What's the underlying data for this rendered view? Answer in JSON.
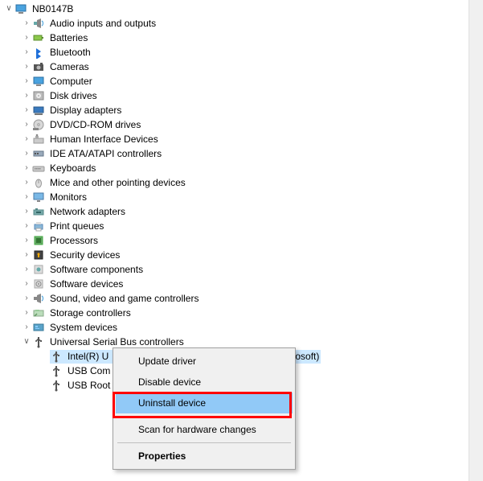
{
  "root": {
    "label": "NB0147B"
  },
  "categories": [
    {
      "id": "audio",
      "label": "Audio inputs and outputs",
      "icon": "audio"
    },
    {
      "id": "batteries",
      "label": "Batteries",
      "icon": "battery"
    },
    {
      "id": "bluetooth",
      "label": "Bluetooth",
      "icon": "bluetooth"
    },
    {
      "id": "cameras",
      "label": "Cameras",
      "icon": "camera"
    },
    {
      "id": "computer",
      "label": "Computer",
      "icon": "monitor"
    },
    {
      "id": "diskdrives",
      "label": "Disk drives",
      "icon": "disk"
    },
    {
      "id": "displayadapters",
      "label": "Display adapters",
      "icon": "display-adapter"
    },
    {
      "id": "dvd",
      "label": "DVD/CD-ROM drives",
      "icon": "dvd"
    },
    {
      "id": "hid",
      "label": "Human Interface Devices",
      "icon": "hid"
    },
    {
      "id": "ide",
      "label": "IDE ATA/ATAPI controllers",
      "icon": "ide"
    },
    {
      "id": "keyboards",
      "label": "Keyboards",
      "icon": "keyboard"
    },
    {
      "id": "mice",
      "label": "Mice and other pointing devices",
      "icon": "mouse"
    },
    {
      "id": "monitors",
      "label": "Monitors",
      "icon": "monitor2"
    },
    {
      "id": "netadapters",
      "label": "Network adapters",
      "icon": "net"
    },
    {
      "id": "printqueues",
      "label": "Print queues",
      "icon": "printer"
    },
    {
      "id": "processors",
      "label": "Processors",
      "icon": "cpu"
    },
    {
      "id": "security",
      "label": "Security devices",
      "icon": "security"
    },
    {
      "id": "swcomp",
      "label": "Software components",
      "icon": "swcomp"
    },
    {
      "id": "swdev",
      "label": "Software devices",
      "icon": "swdev"
    },
    {
      "id": "sound",
      "label": "Sound, video and game controllers",
      "icon": "sound"
    },
    {
      "id": "storage",
      "label": "Storage controllers",
      "icon": "storage"
    },
    {
      "id": "system",
      "label": "System devices",
      "icon": "system"
    },
    {
      "id": "usb",
      "label": "Universal Serial Bus controllers",
      "icon": "usb",
      "expanded": true
    }
  ],
  "usb_children": [
    {
      "id": "usb-intel",
      "label_visible_prefix": "Intel(R) U",
      "label_visible_suffix": "osoft)",
      "selected": true
    },
    {
      "id": "usb-com",
      "label_visible_prefix": "USB Com"
    },
    {
      "id": "usb-root",
      "label_visible_prefix": "USB Root"
    }
  ],
  "context_menu": {
    "items": [
      {
        "id": "update-driver",
        "label": "Update driver"
      },
      {
        "id": "disable-device",
        "label": "Disable device"
      },
      {
        "id": "uninstall-device",
        "label": "Uninstall device",
        "highlighted": true
      },
      {
        "sep": true
      },
      {
        "id": "scan-hw",
        "label": "Scan for hardware changes"
      },
      {
        "sep": true
      },
      {
        "id": "properties",
        "label": "Properties",
        "bold": true
      }
    ]
  }
}
